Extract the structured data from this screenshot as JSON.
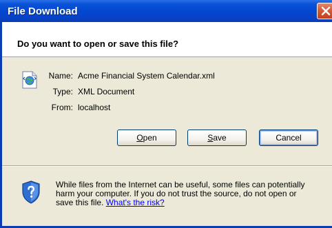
{
  "window": {
    "title": "File Download"
  },
  "prompt": {
    "heading": "Do you want to open or save this file?"
  },
  "file": {
    "icon": "xml-document-icon",
    "name_label": "Name:",
    "name_value": "Acme Financial System Calendar.xml",
    "type_label": "Type:",
    "type_value": "XML Document",
    "from_label": "From:",
    "from_value": "localhost"
  },
  "buttons": {
    "open_prefix": "",
    "open_accel": "O",
    "open_rest": "pen",
    "save_prefix": "",
    "save_accel": "S",
    "save_rest": "ave",
    "cancel_label": "Cancel"
  },
  "warning": {
    "icon": "security-shield-icon",
    "line1": "While files from the Internet can be useful, some files can potentially",
    "line2": "harm your computer. If you do not trust the source, do not open or",
    "line3": "save this file.",
    "link": "What's the risk?"
  },
  "colors": {
    "titlebar": "#0247d0",
    "dialog_bg": "#ece9d8",
    "close_button": "#d55b3a",
    "link": "#0000ee"
  }
}
